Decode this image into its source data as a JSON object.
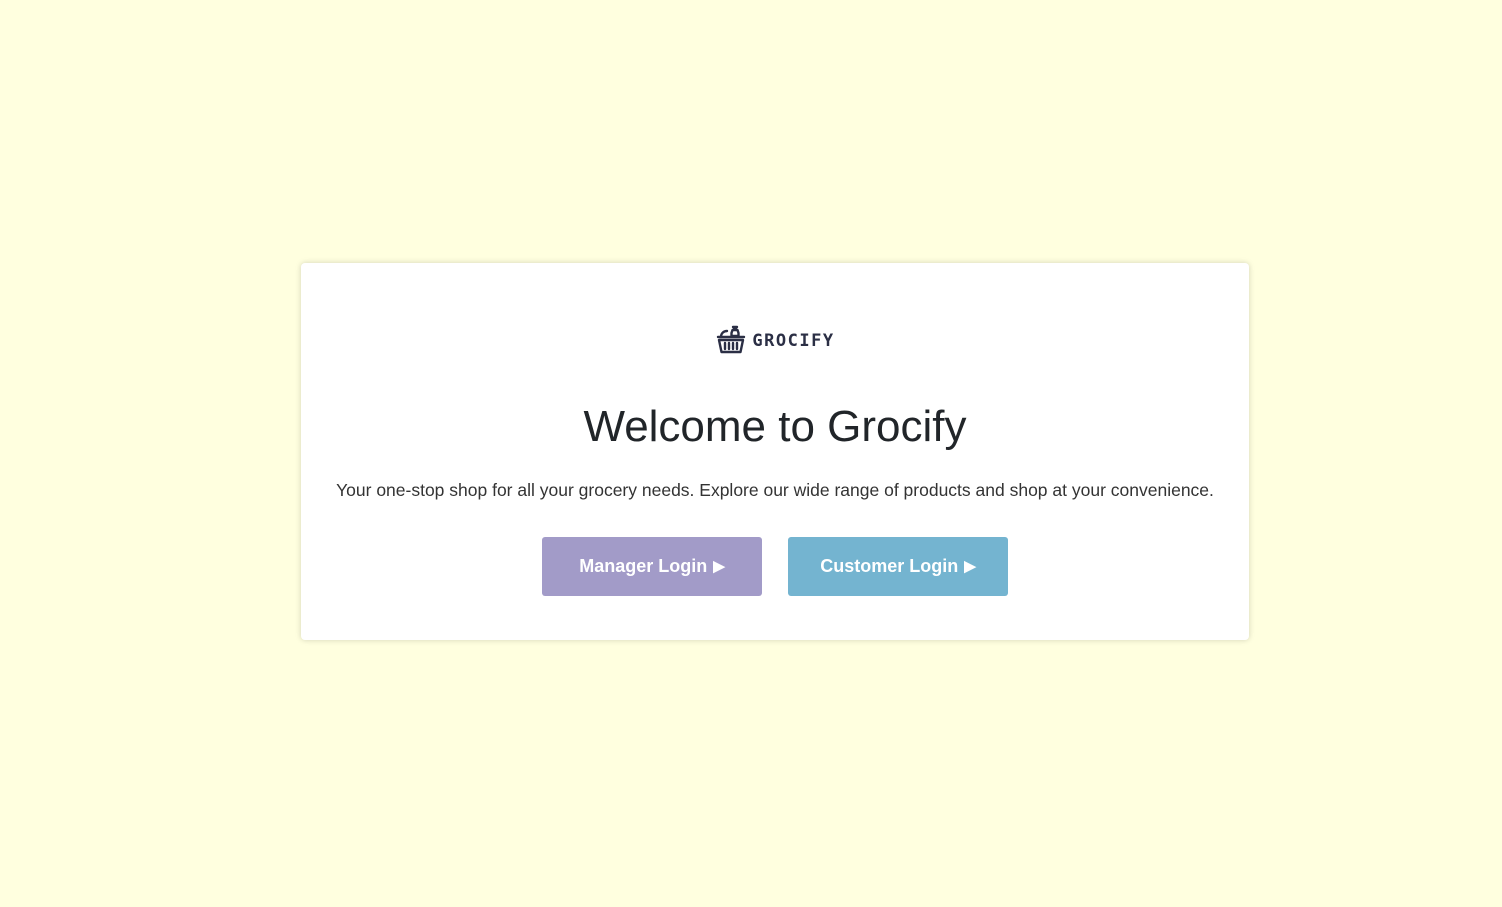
{
  "app": {
    "brand_name": "GROCIFY",
    "logo_icon": "grocery-basket-icon"
  },
  "hero": {
    "title": "Welcome to Grocify",
    "subtitle": "Your one-stop shop for all your grocery needs. Explore our wide range of products and shop at your convenience."
  },
  "actions": {
    "manager_label": "Manager Login",
    "customer_label": "Customer Login",
    "arrow_icon": "play-arrow-icon",
    "arrow_glyph": "▶"
  },
  "colors": {
    "background": "#ffffdf",
    "manager_button": "#a29bc8",
    "customer_button": "#74b4d0",
    "brand_text": "#2b2f45"
  }
}
